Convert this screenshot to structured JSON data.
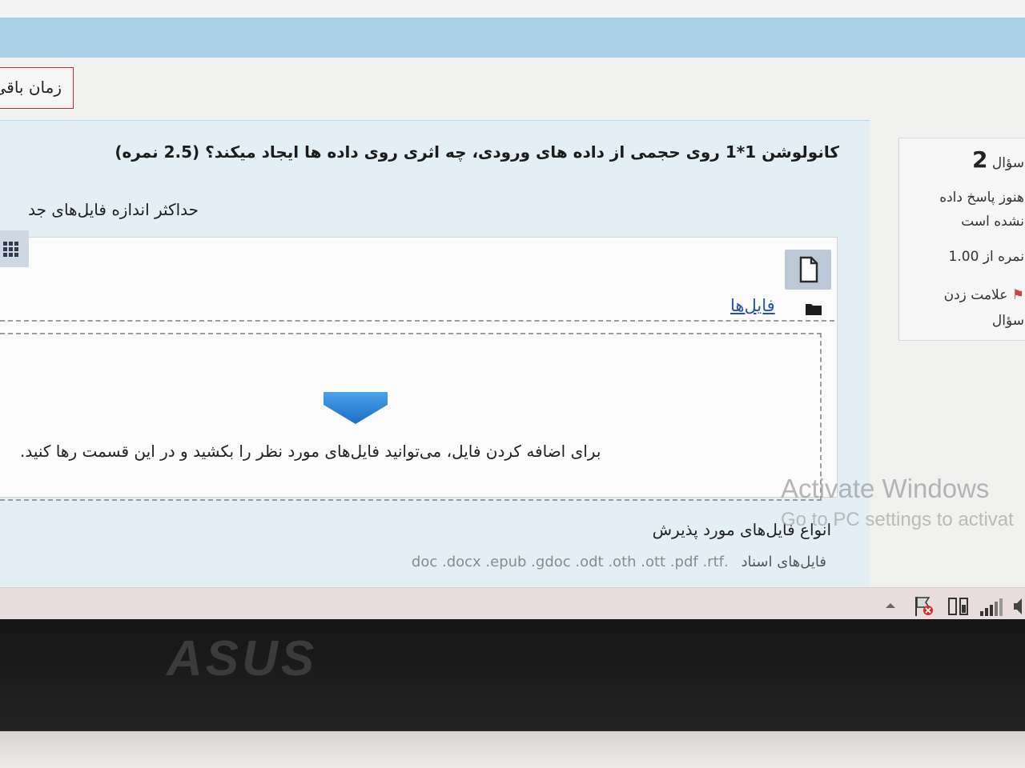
{
  "timer": {
    "label": "زمان باقی"
  },
  "question_info": {
    "label": "سؤال",
    "number": "2",
    "status_line1": "هنوز پاسخ داده",
    "status_line2": "نشده است",
    "grade": "نمره از 1.00",
    "flag_line1": "علامت زدن",
    "flag_line2": "سؤال"
  },
  "question": {
    "text": "کانولوشن 1*1 روی حجمی از داده های ورودی، چه اثری روی داده ها ایجاد میکند؟ (2.5 نمره)",
    "max_size_label": "حداکثر اندازه فایل‌های جد"
  },
  "file_manager": {
    "folder_link": "فایل‌ها",
    "drop_hint": "برای اضافه کردن فایل، می‌توانید فایل‌های مورد نظر را بکشید و در این قسمت رها کنید."
  },
  "accepted_types": {
    "title": "انواع فایل‌های مورد پذیرش",
    "documents_label": "فایل‌های اسناد",
    "documents_exts": ".doc .docx .epub .gdoc .odt .oth .ott .pdf .rtf"
  },
  "watermark": {
    "line1": "Activate Windows",
    "line2": "Go to PC settings to activat"
  },
  "bezel": {
    "brand": "ASUS"
  },
  "colors": {
    "header_bar": "#a9cfe4",
    "question_panel": "#e3eff5",
    "link": "#2553a8",
    "timer_border": "#aa3333",
    "drop_arrow": "#2d86d6"
  }
}
